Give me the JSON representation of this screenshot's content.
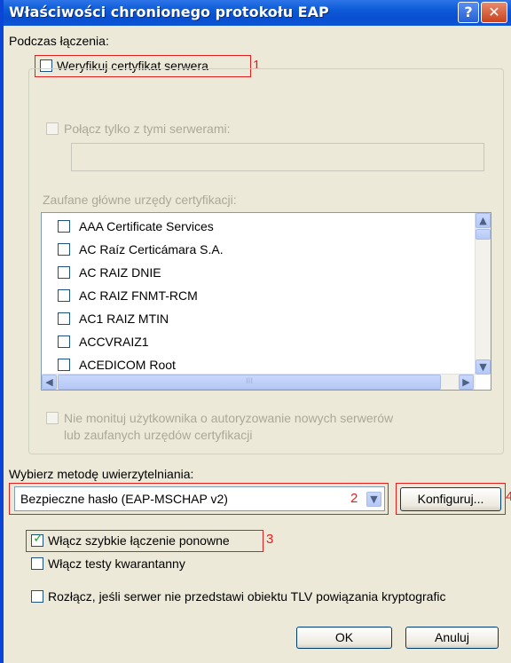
{
  "window": {
    "title": "Właściwości chronionego protokołu EAP",
    "help_glyph": "?",
    "close_glyph": "✕"
  },
  "connect": {
    "label": "Podczas łączenia:",
    "verify_cert": {
      "label": "Weryfikuj certyfikat serwera",
      "checked": false,
      "annotation": "1"
    },
    "connect_servers": {
      "label": "Połącz tylko z tymi serwerami:",
      "checked": false,
      "enabled": false,
      "value": ""
    }
  },
  "trusted_ca": {
    "label": "Zaufane główne urzędy certyfikacji:",
    "items": [
      {
        "label": "AAA Certificate Services",
        "checked": false
      },
      {
        "label": "AC Raíz Certicámara S.A.",
        "checked": false
      },
      {
        "label": "AC RAIZ DNIE",
        "checked": false
      },
      {
        "label": "AC RAIZ FNMT-RCM",
        "checked": false
      },
      {
        "label": "AC1 RAIZ MTIN",
        "checked": false
      },
      {
        "label": "ACCVRAIZ1",
        "checked": false
      },
      {
        "label": "ACEDICOM Root",
        "checked": false
      }
    ],
    "hscroll_label": "III"
  },
  "no_prompt": {
    "label_line1": "Nie monituj użytkownika o autoryzowanie nowych serwerów",
    "label_line2": "lub zaufanych urzędów certyfikacji",
    "checked": false,
    "enabled": false
  },
  "auth": {
    "label": "Wybierz metodę uwierzytelniania:",
    "method": "Bezpieczne hasło (EAP-MSCHAP v2)",
    "method_annotation": "2",
    "configure_label": "Konfiguruj...",
    "configure_annotation": "4"
  },
  "options": {
    "fast_reconnect": {
      "label": "Włącz szybkie łączenie ponowne",
      "checked": true,
      "annotation": "3"
    },
    "quarantine": {
      "label": "Włącz testy kwarantanny",
      "checked": false
    },
    "disconnect_tlv": {
      "label": "Rozłącz, jeśli serwer nie przedstawi obiektu TLV powiązania kryptografic",
      "checked": false
    }
  },
  "buttons": {
    "ok": "OK",
    "cancel": "Anuluj"
  },
  "colors": {
    "title_bar": "#0b5ad8",
    "annotation_red": "#e41d1d",
    "check_green": "#21a121",
    "disabled_text": "#aca899"
  }
}
